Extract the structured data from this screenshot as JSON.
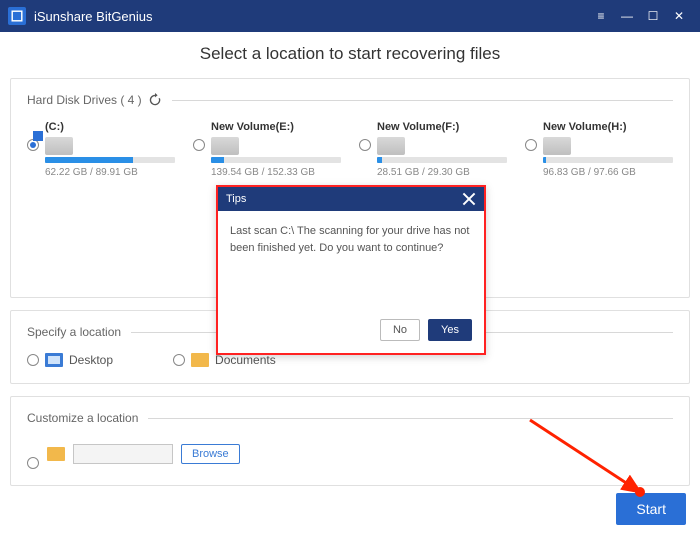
{
  "app": {
    "title": "iSunshare BitGenius"
  },
  "page": {
    "heading": "Select a location to start recovering files"
  },
  "drives_section": {
    "title": "Hard Disk Drives ( 4 )",
    "drives": [
      {
        "label": "(C:)",
        "stats": "62.22 GB / 89.91 GB",
        "fill_pct": 68,
        "selected": true,
        "is_system": true
      },
      {
        "label": "New Volume(E:)",
        "stats": "139.54 GB / 152.33 GB",
        "fill_pct": 10,
        "selected": false,
        "is_system": false
      },
      {
        "label": "New Volume(F:)",
        "stats": "28.51 GB / 29.30 GB",
        "fill_pct": 4,
        "selected": false,
        "is_system": false
      },
      {
        "label": "New Volume(H:)",
        "stats": "96.83 GB / 97.66 GB",
        "fill_pct": 2,
        "selected": false,
        "is_system": false
      }
    ]
  },
  "specify_section": {
    "title": "Specify a location",
    "items": [
      {
        "label": "Desktop"
      },
      {
        "label": "Documents"
      }
    ]
  },
  "customize_section": {
    "title": "Customize a location",
    "browse_label": "Browse"
  },
  "start_label": "Start",
  "dialog": {
    "title": "Tips",
    "body": "Last scan C:\\ The scanning for your drive has not been finished yet. Do you want to continue?",
    "no": "No",
    "yes": "Yes"
  }
}
